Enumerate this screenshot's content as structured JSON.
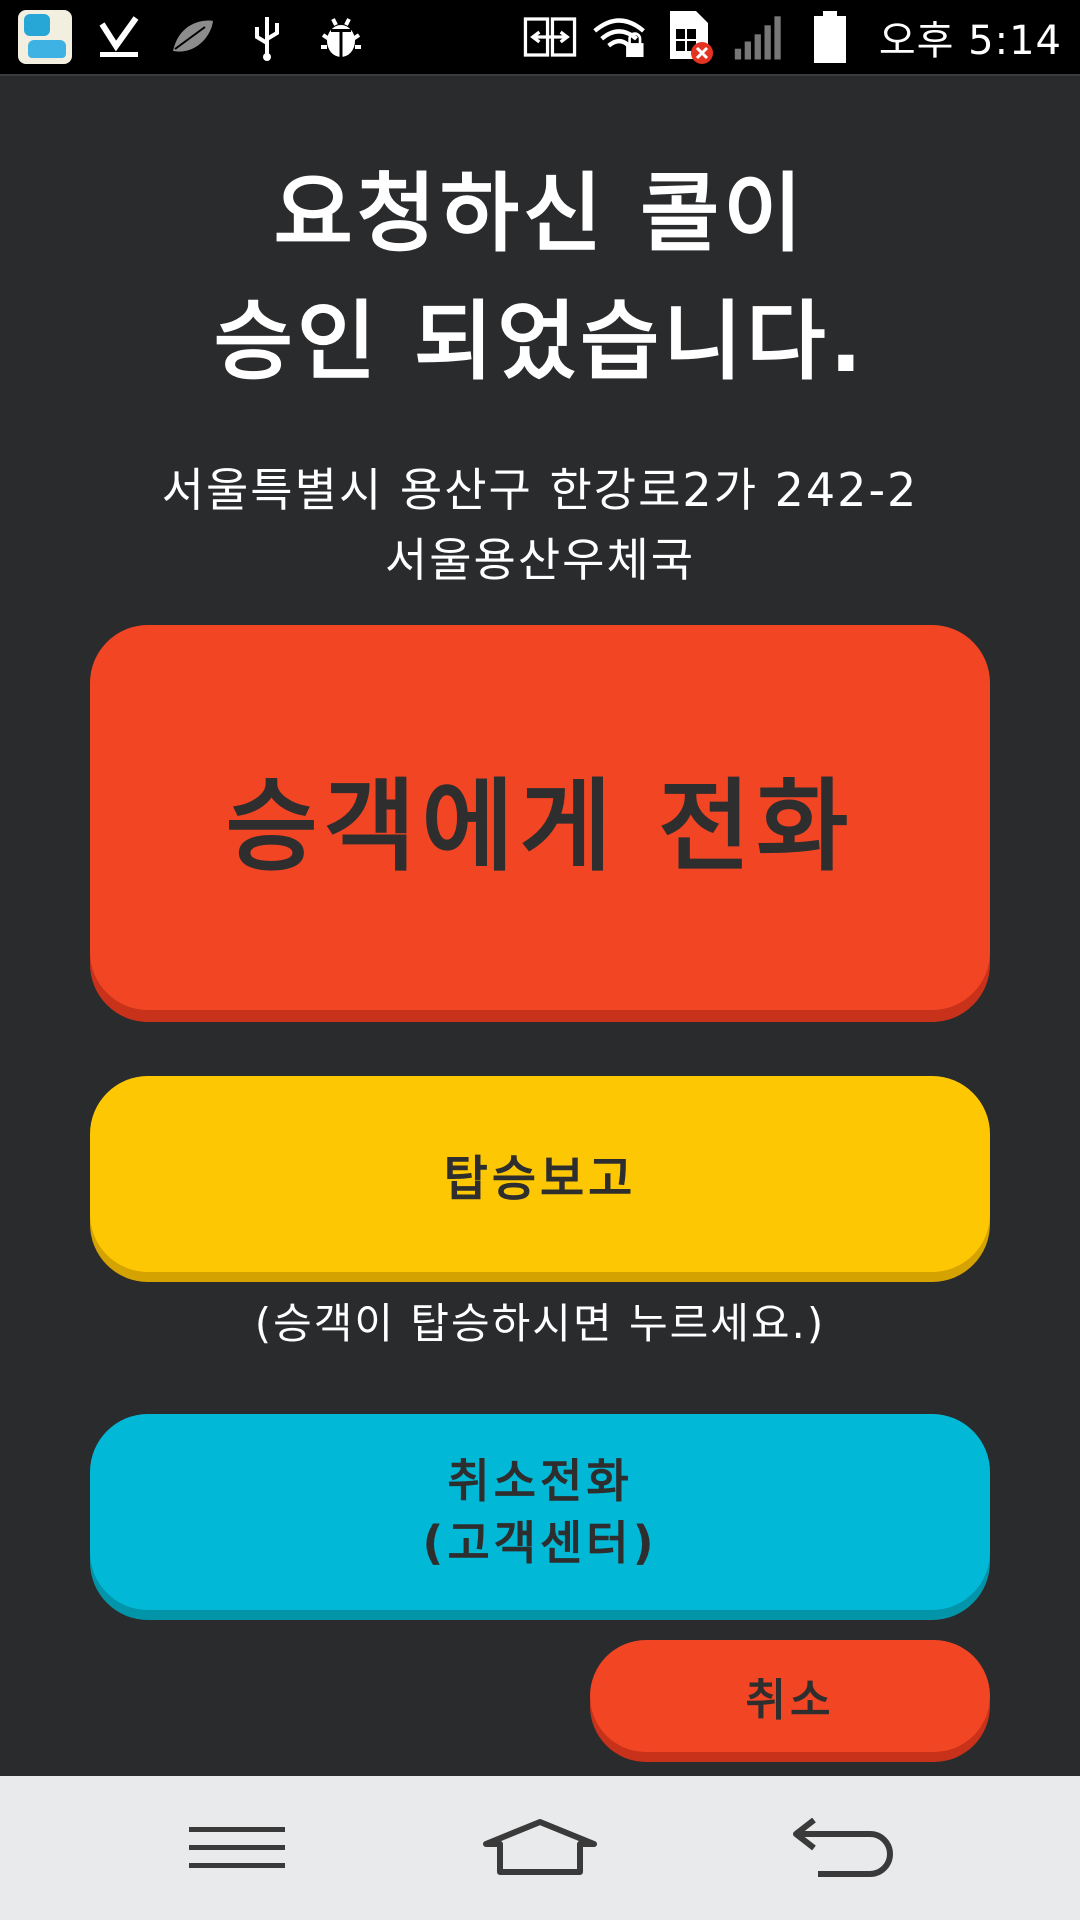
{
  "status_bar": {
    "time": "오후 5:14",
    "left_icons": [
      "app-badge-icon",
      "download-done-icon",
      "leaf-icon",
      "usb-icon",
      "bug-icon"
    ],
    "right_icons": [
      "screen-mirror-icon",
      "wifi-lock-icon",
      "sim-error-icon",
      "signal-icon",
      "battery-icon"
    ]
  },
  "headline": {
    "line1": "요청하신 콜이",
    "line2": "승인 되었습니다."
  },
  "address": {
    "line1": "서울특별시 용산구 한강로2가 242-2",
    "line2": "서울용산우체국"
  },
  "buttons": {
    "call_passenger": "승객에게 전화",
    "boarding_report": "탑승보고",
    "boarding_note": "(승객이 탑승하시면 누르세요.)",
    "cancel_call_line1": "취소전화",
    "cancel_call_line2": "(고객센터)",
    "cancel": "취소"
  },
  "colors": {
    "background": "#2a2b2d",
    "call_button": "#f24524",
    "boarding_button": "#fec703",
    "cancel_call_button": "#01b9d6",
    "cancel_button": "#f24524",
    "button_text": "#2e2e2e"
  },
  "nav_bar": {
    "icons": [
      "menu-icon",
      "home-icon",
      "back-icon"
    ]
  }
}
